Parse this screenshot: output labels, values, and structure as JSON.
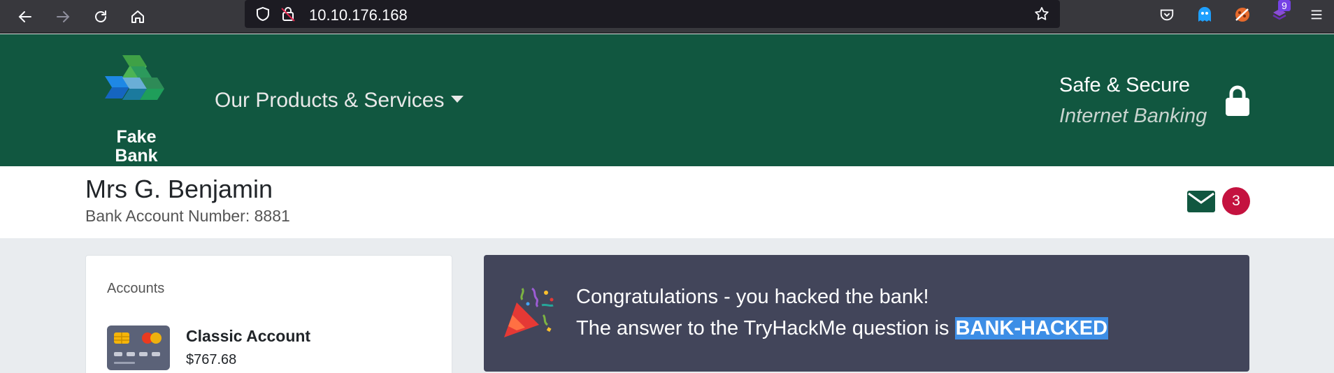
{
  "browser": {
    "url": "10.10.176.168",
    "extension_badge": "9"
  },
  "header": {
    "logo_line1": "Fake",
    "logo_line2": "Bank",
    "products_nav": "Our Products & Services",
    "secure_line1": "Safe & Secure",
    "secure_line2": "Internet Banking"
  },
  "account": {
    "name": "Mrs G. Benjamin",
    "number_label": "Bank Account Number: 8881",
    "message_count": "3"
  },
  "accounts_card": {
    "title": "Accounts",
    "items": [
      {
        "name": "Classic Account",
        "balance": "$767.68"
      }
    ]
  },
  "congrats": {
    "line1": "Congratulations - you hacked the bank!",
    "line2_prefix": "The answer to the TryHackMe question is ",
    "answer": "BANK-HACKED"
  },
  "colors": {
    "header_bg": "#115740",
    "badge_red": "#c4123f",
    "panel_bg": "#42455a",
    "highlight": "#3d8ee6"
  }
}
